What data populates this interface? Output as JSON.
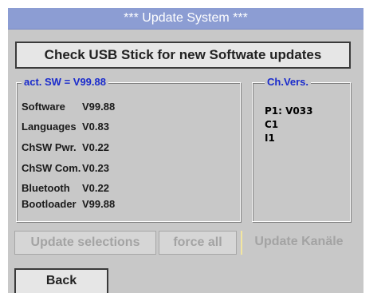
{
  "title": "***  Update System  ***",
  "check_button": "Check USB Stick for new Softwate updates",
  "sw_group": {
    "legend": "act. SW = V99.88",
    "rows": [
      {
        "name": "Software",
        "version": "V99.88"
      },
      {
        "name": "Languages",
        "version": "V0.83"
      },
      {
        "name": "ChSW Pwr.",
        "version": "V0.22"
      },
      {
        "name": "ChSW Com.",
        "version": "V0.23"
      },
      {
        "name": "Bluetooth",
        "version": "V0.22"
      },
      {
        "name": "Bootloader",
        "version": "V99.88"
      }
    ]
  },
  "ch_group": {
    "legend": "Ch.Vers.",
    "lines": [
      "P1: V033",
      "C1",
      "I1"
    ]
  },
  "buttons": {
    "update_selections": "Update selections",
    "force_all": "force all",
    "update_kanaele": "Update Kanäle",
    "back": "Back"
  },
  "colors": {
    "title_bar": "#8c9dd3",
    "panel": "#c8c8c8",
    "legend_text": "#1a2bcc"
  }
}
